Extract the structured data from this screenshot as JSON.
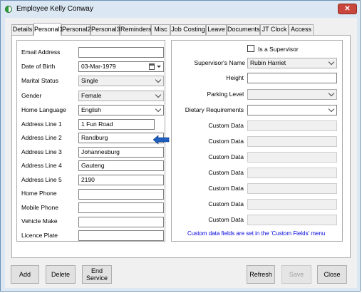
{
  "window": {
    "title": "Employee Kelly Conway",
    "close_label": "✕"
  },
  "tabs": [
    {
      "label": "Details"
    },
    {
      "label": "Personal1"
    },
    {
      "label": "Personal2"
    },
    {
      "label": "Personal3"
    },
    {
      "label": "Reminders"
    },
    {
      "label": "Misc"
    },
    {
      "label": "Job Costing"
    },
    {
      "label": "Leave"
    },
    {
      "label": "Documents"
    },
    {
      "label": "JT Clock"
    },
    {
      "label": "Access"
    }
  ],
  "left": {
    "email_label": "Email Address",
    "email_value": "",
    "dob_label": "Date of Birth",
    "dob_value": "03-Mar-1979",
    "marital_label": "Marital Status",
    "marital_value": "Single",
    "gender_label": "Gender",
    "gender_value": "Female",
    "language_label": "Home Language",
    "language_value": "English",
    "addr1_label": "Address Line 1",
    "addr1_value": "1 Fun Road",
    "addr2_label": "Address Line 2",
    "addr2_value": "Randburg",
    "addr3_label": "Address Line 3",
    "addr3_value": "Johannesburg",
    "addr4_label": "Address Line 4",
    "addr4_value": "Gauteng",
    "addr5_label": "Address Line 5",
    "addr5_value": "2190",
    "home_phone_label": "Home Phone",
    "home_phone_value": "",
    "mobile_label": "Mobile Phone",
    "mobile_value": "",
    "vehicle_label": "Vehicle Make",
    "vehicle_value": "",
    "plate_label": "Licence Plate",
    "plate_value": ""
  },
  "right": {
    "is_supervisor_label": "Is a Supervisor",
    "supervisor_name_label": "Supervisor's Name",
    "supervisor_name_value": "Rubin Harriet",
    "height_label": "Height",
    "height_value": "",
    "parking_label": "Parking Level",
    "parking_value": "",
    "dietary_label": "Dietary Requirements",
    "dietary_value": "",
    "custom_label": "Custom Data",
    "custom_fields": [
      "",
      "",
      "",
      "",
      "",
      "",
      ""
    ],
    "custom_note": "Custom data fields are set in the 'Custom Fields' menu"
  },
  "buttons": {
    "add": "Add",
    "delete": "Delete",
    "end_service_line1": "End",
    "end_service_line2": "Service",
    "refresh": "Refresh",
    "save": "Save",
    "close": "Close"
  },
  "colors": {
    "arrow_blue": "#1f5fbf",
    "note_blue": "#0000dd"
  }
}
